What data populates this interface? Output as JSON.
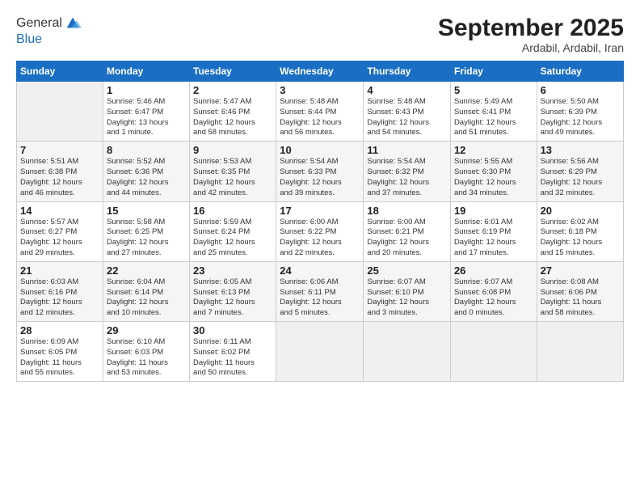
{
  "header": {
    "logo_line1": "General",
    "logo_line2": "Blue",
    "month_title": "September 2025",
    "subtitle": "Ardabil, Ardabil, Iran"
  },
  "weekdays": [
    "Sunday",
    "Monday",
    "Tuesday",
    "Wednesday",
    "Thursday",
    "Friday",
    "Saturday"
  ],
  "weeks": [
    [
      {
        "day": "",
        "info": ""
      },
      {
        "day": "1",
        "info": "Sunrise: 5:46 AM\nSunset: 6:47 PM\nDaylight: 13 hours\nand 1 minute."
      },
      {
        "day": "2",
        "info": "Sunrise: 5:47 AM\nSunset: 6:46 PM\nDaylight: 12 hours\nand 58 minutes."
      },
      {
        "day": "3",
        "info": "Sunrise: 5:48 AM\nSunset: 6:44 PM\nDaylight: 12 hours\nand 56 minutes."
      },
      {
        "day": "4",
        "info": "Sunrise: 5:48 AM\nSunset: 6:43 PM\nDaylight: 12 hours\nand 54 minutes."
      },
      {
        "day": "5",
        "info": "Sunrise: 5:49 AM\nSunset: 6:41 PM\nDaylight: 12 hours\nand 51 minutes."
      },
      {
        "day": "6",
        "info": "Sunrise: 5:50 AM\nSunset: 6:39 PM\nDaylight: 12 hours\nand 49 minutes."
      }
    ],
    [
      {
        "day": "7",
        "info": "Sunrise: 5:51 AM\nSunset: 6:38 PM\nDaylight: 12 hours\nand 46 minutes."
      },
      {
        "day": "8",
        "info": "Sunrise: 5:52 AM\nSunset: 6:36 PM\nDaylight: 12 hours\nand 44 minutes."
      },
      {
        "day": "9",
        "info": "Sunrise: 5:53 AM\nSunset: 6:35 PM\nDaylight: 12 hours\nand 42 minutes."
      },
      {
        "day": "10",
        "info": "Sunrise: 5:54 AM\nSunset: 6:33 PM\nDaylight: 12 hours\nand 39 minutes."
      },
      {
        "day": "11",
        "info": "Sunrise: 5:54 AM\nSunset: 6:32 PM\nDaylight: 12 hours\nand 37 minutes."
      },
      {
        "day": "12",
        "info": "Sunrise: 5:55 AM\nSunset: 6:30 PM\nDaylight: 12 hours\nand 34 minutes."
      },
      {
        "day": "13",
        "info": "Sunrise: 5:56 AM\nSunset: 6:29 PM\nDaylight: 12 hours\nand 32 minutes."
      }
    ],
    [
      {
        "day": "14",
        "info": "Sunrise: 5:57 AM\nSunset: 6:27 PM\nDaylight: 12 hours\nand 29 minutes."
      },
      {
        "day": "15",
        "info": "Sunrise: 5:58 AM\nSunset: 6:25 PM\nDaylight: 12 hours\nand 27 minutes."
      },
      {
        "day": "16",
        "info": "Sunrise: 5:59 AM\nSunset: 6:24 PM\nDaylight: 12 hours\nand 25 minutes."
      },
      {
        "day": "17",
        "info": "Sunrise: 6:00 AM\nSunset: 6:22 PM\nDaylight: 12 hours\nand 22 minutes."
      },
      {
        "day": "18",
        "info": "Sunrise: 6:00 AM\nSunset: 6:21 PM\nDaylight: 12 hours\nand 20 minutes."
      },
      {
        "day": "19",
        "info": "Sunrise: 6:01 AM\nSunset: 6:19 PM\nDaylight: 12 hours\nand 17 minutes."
      },
      {
        "day": "20",
        "info": "Sunrise: 6:02 AM\nSunset: 6:18 PM\nDaylight: 12 hours\nand 15 minutes."
      }
    ],
    [
      {
        "day": "21",
        "info": "Sunrise: 6:03 AM\nSunset: 6:16 PM\nDaylight: 12 hours\nand 12 minutes."
      },
      {
        "day": "22",
        "info": "Sunrise: 6:04 AM\nSunset: 6:14 PM\nDaylight: 12 hours\nand 10 minutes."
      },
      {
        "day": "23",
        "info": "Sunrise: 6:05 AM\nSunset: 6:13 PM\nDaylight: 12 hours\nand 7 minutes."
      },
      {
        "day": "24",
        "info": "Sunrise: 6:06 AM\nSunset: 6:11 PM\nDaylight: 12 hours\nand 5 minutes."
      },
      {
        "day": "25",
        "info": "Sunrise: 6:07 AM\nSunset: 6:10 PM\nDaylight: 12 hours\nand 3 minutes."
      },
      {
        "day": "26",
        "info": "Sunrise: 6:07 AM\nSunset: 6:08 PM\nDaylight: 12 hours\nand 0 minutes."
      },
      {
        "day": "27",
        "info": "Sunrise: 6:08 AM\nSunset: 6:06 PM\nDaylight: 11 hours\nand 58 minutes."
      }
    ],
    [
      {
        "day": "28",
        "info": "Sunrise: 6:09 AM\nSunset: 6:05 PM\nDaylight: 11 hours\nand 55 minutes."
      },
      {
        "day": "29",
        "info": "Sunrise: 6:10 AM\nSunset: 6:03 PM\nDaylight: 11 hours\nand 53 minutes."
      },
      {
        "day": "30",
        "info": "Sunrise: 6:11 AM\nSunset: 6:02 PM\nDaylight: 11 hours\nand 50 minutes."
      },
      {
        "day": "",
        "info": ""
      },
      {
        "day": "",
        "info": ""
      },
      {
        "day": "",
        "info": ""
      },
      {
        "day": "",
        "info": ""
      }
    ]
  ]
}
